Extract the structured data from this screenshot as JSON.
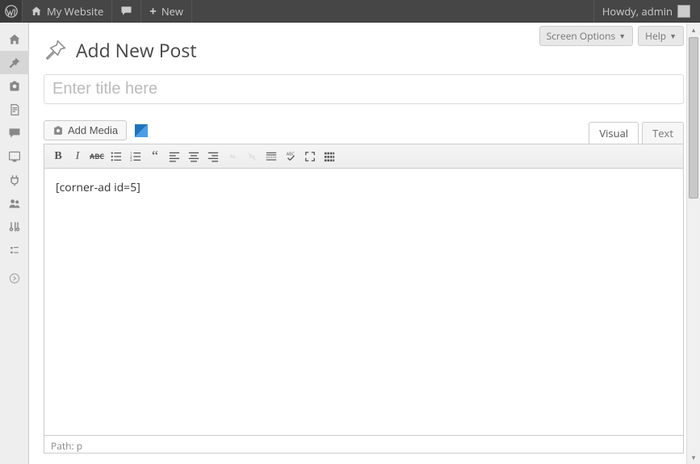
{
  "adminbar": {
    "site_name": "My Website",
    "new_label": "New",
    "howdy": "Howdy, admin"
  },
  "sidebar_items": [
    {
      "name": "dashboard",
      "icon": "home"
    },
    {
      "name": "posts",
      "icon": "pin",
      "active": true
    },
    {
      "name": "media",
      "icon": "media"
    },
    {
      "name": "pages",
      "icon": "pages"
    },
    {
      "name": "comments",
      "icon": "comment"
    },
    {
      "name": "appearance",
      "icon": "appearance"
    },
    {
      "name": "plugins",
      "icon": "plugins"
    },
    {
      "name": "users",
      "icon": "users"
    },
    {
      "name": "tools",
      "icon": "tools"
    },
    {
      "name": "settings",
      "icon": "settings"
    }
  ],
  "screen_meta": {
    "screen_options": "Screen Options",
    "help": "Help"
  },
  "page": {
    "title": "Add New Post",
    "title_placeholder": "Enter title here",
    "add_media": "Add Media"
  },
  "editor": {
    "tabs": {
      "visual": "Visual",
      "text": "Text"
    },
    "content": "[corner-ad id=5]",
    "path_label": "Path: p"
  }
}
